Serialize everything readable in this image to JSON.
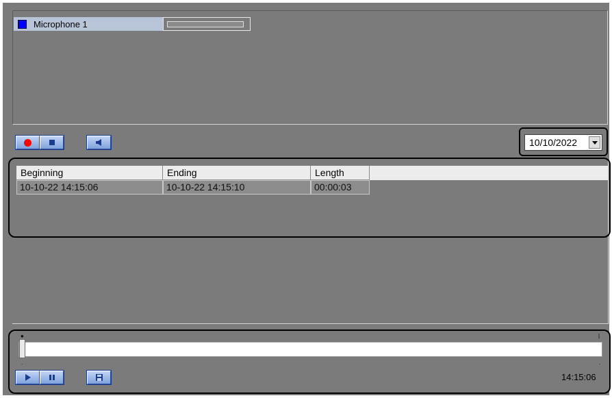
{
  "microphone": {
    "name": "Microphone 1",
    "level": 0
  },
  "toolbar": {
    "record_icon": "record-icon",
    "stop_icon": "stop-icon",
    "speaker_icon": "speaker-icon"
  },
  "date_picker": {
    "value": "10/10/2022"
  },
  "recordings": {
    "columns": [
      "Beginning",
      "Ending",
      "Length"
    ],
    "rows": [
      [
        "10-10-22 14:15:06",
        "10-10-22 14:15:10",
        "00:00:03"
      ]
    ]
  },
  "player": {
    "play_icon": "play-icon",
    "pause_icon": "pause-icon",
    "save_icon": "save-icon",
    "position": 0,
    "current_time": "14:15:06"
  },
  "colors": {
    "background": "#7b7b7b",
    "microphone_indicator": "#0000ff",
    "record": "#ff0000",
    "button": "#8fb0e6"
  }
}
